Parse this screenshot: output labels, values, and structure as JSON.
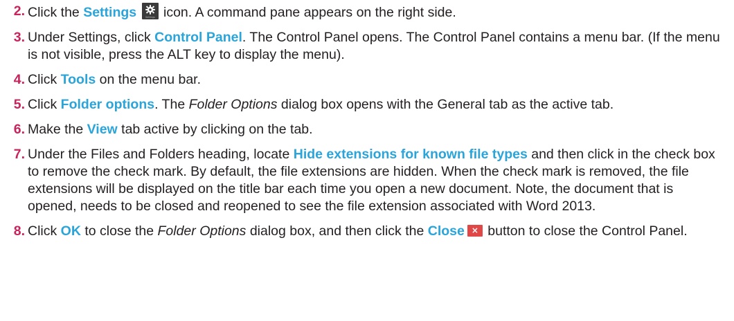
{
  "steps": [
    {
      "num": "2.",
      "parts": [
        "Click the ",
        "Settings",
        " icon. A command pane appears on the right side."
      ],
      "icon_name": "settings-gear-icon",
      "icon_caption": "Settings"
    },
    {
      "num": "3.",
      "parts": [
        "Under Settings, click ",
        "Control Panel",
        ". The Control Panel opens. The Control Panel contains a menu bar. (If the menu is not visible, press the ALT key to display the menu)."
      ]
    },
    {
      "num": "4.",
      "parts": [
        "Click ",
        "Tools",
        " on the menu bar."
      ]
    },
    {
      "num": "5.",
      "parts": [
        "Click ",
        "Folder options",
        ". The ",
        "Folder Options",
        " dialog box opens with the General tab as the active tab."
      ]
    },
    {
      "num": "6.",
      "parts": [
        "Make the ",
        "View",
        " tab active by clicking on the tab."
      ]
    },
    {
      "num": "7.",
      "parts": [
        "Under the Files and Folders heading, locate ",
        "Hide extensions for known file types",
        " and then click in the check box to remove the check mark. By default, the file extensions are hidden. When the check mark is removed, the file extensions will be displayed on the title bar each time you open a new document. Note, the document that is opened, needs to be closed and reopened to see the file extension associated with Word 2013."
      ]
    },
    {
      "num": "8.",
      "parts": [
        "Click ",
        "OK",
        " to close the ",
        "Folder Options",
        " dialog box, and then click the ",
        "Close",
        " button to close the Control Panel."
      ],
      "icon_name": "close-x-icon",
      "icon_glyph": "×"
    }
  ],
  "colors": {
    "step_number": "#c8235d",
    "keyword": "#2aa4d9",
    "body_text": "#231f20",
    "settings_icon_bg": "#3a3a3a",
    "close_icon_bg": "#e04848"
  }
}
